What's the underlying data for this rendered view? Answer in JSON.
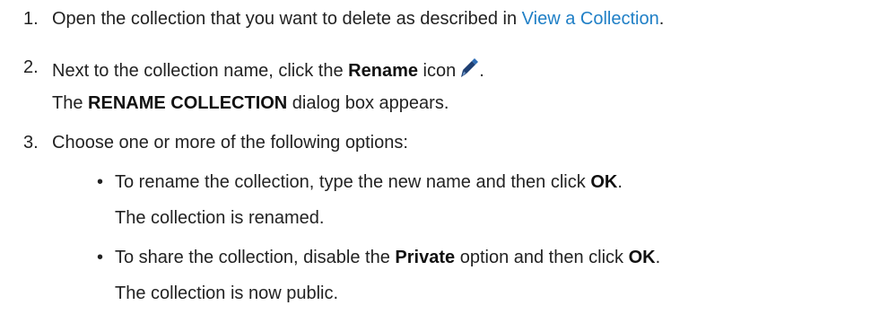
{
  "steps": [
    {
      "number": "1.",
      "text_before": "Open the collection that you want to delete as described in ",
      "link": "View a Collection",
      "text_after": "."
    },
    {
      "number": "2.",
      "text_before": "Next to the collection name, click the ",
      "bold": "Rename",
      "text_after": " icon",
      "trailing": ".",
      "icon": "pencil-icon",
      "result_before": "The ",
      "result_bold": "RENAME COLLECTION",
      "result_after": " dialog box appears."
    },
    {
      "number": "3.",
      "text": "Choose one or more of the following options:",
      "options": [
        {
          "bullet": "•",
          "text_before": "To rename the collection, type the new name and then click ",
          "bold": "OK",
          "text_after": ".",
          "result": "The collection is renamed."
        },
        {
          "bullet": "•",
          "text_before": "To share the collection, disable the ",
          "bold": "Private",
          "text_middle": " option and then click ",
          "bold2": "OK",
          "text_after": ".",
          "result": "The collection is now public."
        }
      ]
    }
  ],
  "colors": {
    "link": "#1f7fc6",
    "text": "#222222",
    "icon": "#1e3f73"
  }
}
